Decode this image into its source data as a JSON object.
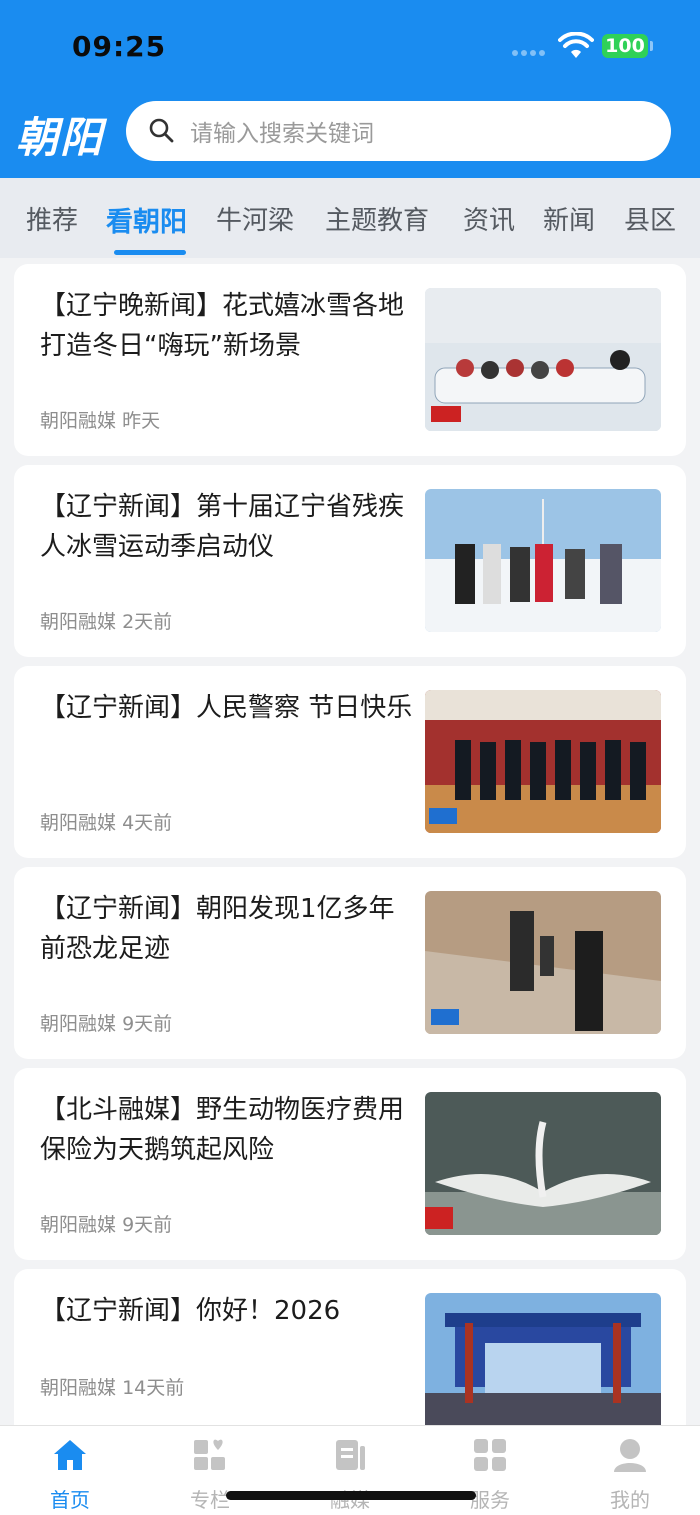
{
  "status": {
    "time": "09:25",
    "battery": "100"
  },
  "header": {
    "logo": "朝阳",
    "search_placeholder": "请输入搜索关键词"
  },
  "tabs": [
    {
      "label": "推荐"
    },
    {
      "label": "看朝阳"
    },
    {
      "label": "牛河梁"
    },
    {
      "label": "主题教育"
    },
    {
      "label": "资讯"
    },
    {
      "label": "新闻"
    },
    {
      "label": "县区"
    }
  ],
  "active_tab": "看朝阳",
  "articles": [
    {
      "title": "【辽宁晚新闻】花式嬉冰雪各地打造冬日“嗨玩”新场景",
      "source": "朝阳融媒",
      "time": "昨天"
    },
    {
      "title": "【辽宁新闻】第十届辽宁省残疾人冰雪运动季启动仪",
      "source": "朝阳融媒",
      "time": "2天前"
    },
    {
      "title": "【辽宁新闻】人民警察 节日快乐",
      "source": "朝阳融媒",
      "time": "4天前"
    },
    {
      "title": "【辽宁新闻】朝阳发现1亿多年前恐龙足迹",
      "source": "朝阳融媒",
      "time": "9天前"
    },
    {
      "title": "【北斗融媒】野生动物医疗费用保险为天鹅筑起风险",
      "source": "朝阳融媒",
      "time": "9天前"
    },
    {
      "title": "【辽宁新闻】你好！2026",
      "source": "朝阳融媒",
      "time": "14天前"
    }
  ],
  "bottom_nav": [
    {
      "label": "首页",
      "icon": "home-icon"
    },
    {
      "label": "专栏",
      "icon": "column-icon"
    },
    {
      "label": "融媒",
      "icon": "media-icon"
    },
    {
      "label": "服务",
      "icon": "grid-icon"
    },
    {
      "label": "我的",
      "icon": "user-icon"
    }
  ],
  "colors": {
    "brand": "#1a8cf0",
    "header_bg": "#1a8cf0",
    "tab_bg": "#e8ebf0"
  }
}
